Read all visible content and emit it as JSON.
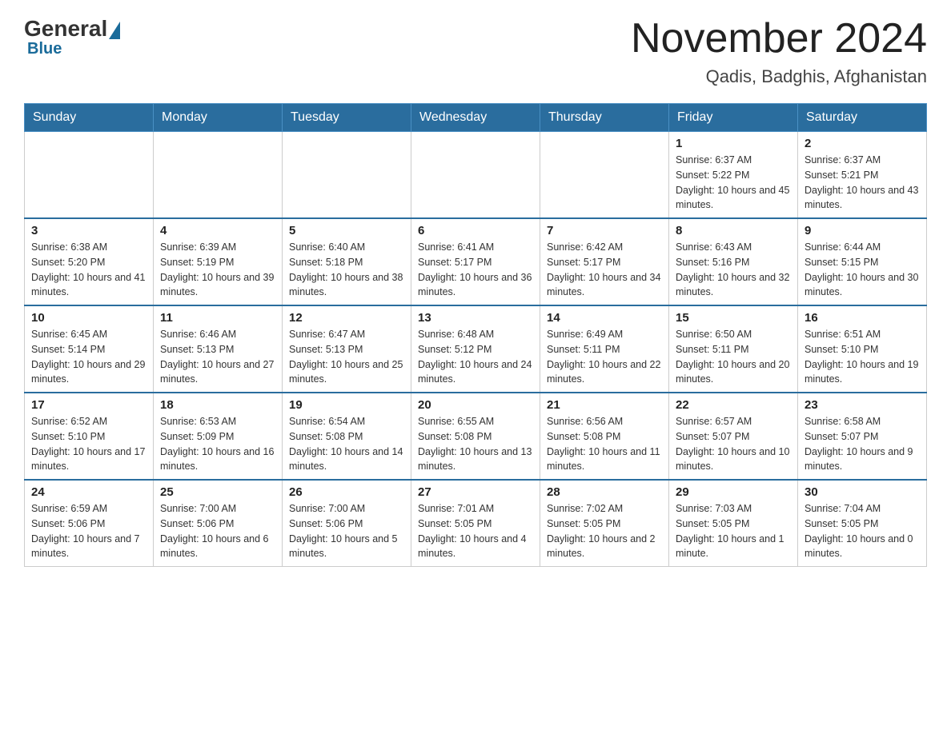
{
  "header": {
    "logo_general": "General",
    "logo_blue": "Blue",
    "month_year": "November 2024",
    "location": "Qadis, Badghis, Afghanistan"
  },
  "days_of_week": [
    "Sunday",
    "Monday",
    "Tuesday",
    "Wednesday",
    "Thursday",
    "Friday",
    "Saturday"
  ],
  "weeks": [
    [
      {
        "day": "",
        "info": ""
      },
      {
        "day": "",
        "info": ""
      },
      {
        "day": "",
        "info": ""
      },
      {
        "day": "",
        "info": ""
      },
      {
        "day": "",
        "info": ""
      },
      {
        "day": "1",
        "info": "Sunrise: 6:37 AM\nSunset: 5:22 PM\nDaylight: 10 hours and 45 minutes."
      },
      {
        "day": "2",
        "info": "Sunrise: 6:37 AM\nSunset: 5:21 PM\nDaylight: 10 hours and 43 minutes."
      }
    ],
    [
      {
        "day": "3",
        "info": "Sunrise: 6:38 AM\nSunset: 5:20 PM\nDaylight: 10 hours and 41 minutes."
      },
      {
        "day": "4",
        "info": "Sunrise: 6:39 AM\nSunset: 5:19 PM\nDaylight: 10 hours and 39 minutes."
      },
      {
        "day": "5",
        "info": "Sunrise: 6:40 AM\nSunset: 5:18 PM\nDaylight: 10 hours and 38 minutes."
      },
      {
        "day": "6",
        "info": "Sunrise: 6:41 AM\nSunset: 5:17 PM\nDaylight: 10 hours and 36 minutes."
      },
      {
        "day": "7",
        "info": "Sunrise: 6:42 AM\nSunset: 5:17 PM\nDaylight: 10 hours and 34 minutes."
      },
      {
        "day": "8",
        "info": "Sunrise: 6:43 AM\nSunset: 5:16 PM\nDaylight: 10 hours and 32 minutes."
      },
      {
        "day": "9",
        "info": "Sunrise: 6:44 AM\nSunset: 5:15 PM\nDaylight: 10 hours and 30 minutes."
      }
    ],
    [
      {
        "day": "10",
        "info": "Sunrise: 6:45 AM\nSunset: 5:14 PM\nDaylight: 10 hours and 29 minutes."
      },
      {
        "day": "11",
        "info": "Sunrise: 6:46 AM\nSunset: 5:13 PM\nDaylight: 10 hours and 27 minutes."
      },
      {
        "day": "12",
        "info": "Sunrise: 6:47 AM\nSunset: 5:13 PM\nDaylight: 10 hours and 25 minutes."
      },
      {
        "day": "13",
        "info": "Sunrise: 6:48 AM\nSunset: 5:12 PM\nDaylight: 10 hours and 24 minutes."
      },
      {
        "day": "14",
        "info": "Sunrise: 6:49 AM\nSunset: 5:11 PM\nDaylight: 10 hours and 22 minutes."
      },
      {
        "day": "15",
        "info": "Sunrise: 6:50 AM\nSunset: 5:11 PM\nDaylight: 10 hours and 20 minutes."
      },
      {
        "day": "16",
        "info": "Sunrise: 6:51 AM\nSunset: 5:10 PM\nDaylight: 10 hours and 19 minutes."
      }
    ],
    [
      {
        "day": "17",
        "info": "Sunrise: 6:52 AM\nSunset: 5:10 PM\nDaylight: 10 hours and 17 minutes."
      },
      {
        "day": "18",
        "info": "Sunrise: 6:53 AM\nSunset: 5:09 PM\nDaylight: 10 hours and 16 minutes."
      },
      {
        "day": "19",
        "info": "Sunrise: 6:54 AM\nSunset: 5:08 PM\nDaylight: 10 hours and 14 minutes."
      },
      {
        "day": "20",
        "info": "Sunrise: 6:55 AM\nSunset: 5:08 PM\nDaylight: 10 hours and 13 minutes."
      },
      {
        "day": "21",
        "info": "Sunrise: 6:56 AM\nSunset: 5:08 PM\nDaylight: 10 hours and 11 minutes."
      },
      {
        "day": "22",
        "info": "Sunrise: 6:57 AM\nSunset: 5:07 PM\nDaylight: 10 hours and 10 minutes."
      },
      {
        "day": "23",
        "info": "Sunrise: 6:58 AM\nSunset: 5:07 PM\nDaylight: 10 hours and 9 minutes."
      }
    ],
    [
      {
        "day": "24",
        "info": "Sunrise: 6:59 AM\nSunset: 5:06 PM\nDaylight: 10 hours and 7 minutes."
      },
      {
        "day": "25",
        "info": "Sunrise: 7:00 AM\nSunset: 5:06 PM\nDaylight: 10 hours and 6 minutes."
      },
      {
        "day": "26",
        "info": "Sunrise: 7:00 AM\nSunset: 5:06 PM\nDaylight: 10 hours and 5 minutes."
      },
      {
        "day": "27",
        "info": "Sunrise: 7:01 AM\nSunset: 5:05 PM\nDaylight: 10 hours and 4 minutes."
      },
      {
        "day": "28",
        "info": "Sunrise: 7:02 AM\nSunset: 5:05 PM\nDaylight: 10 hours and 2 minutes."
      },
      {
        "day": "29",
        "info": "Sunrise: 7:03 AM\nSunset: 5:05 PM\nDaylight: 10 hours and 1 minute."
      },
      {
        "day": "30",
        "info": "Sunrise: 7:04 AM\nSunset: 5:05 PM\nDaylight: 10 hours and 0 minutes."
      }
    ]
  ]
}
